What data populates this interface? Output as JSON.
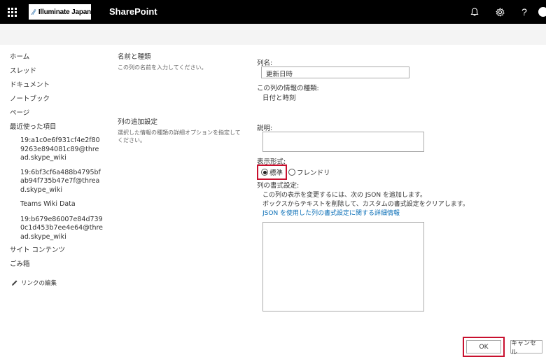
{
  "suitebar": {
    "logo_text": "Illuminate Japan",
    "app_title": "SharePoint"
  },
  "leftnav": {
    "items": [
      {
        "label": "ホーム"
      },
      {
        "label": "スレッド"
      },
      {
        "label": "ドキュメント"
      },
      {
        "label": "ノートブック"
      },
      {
        "label": "ページ"
      },
      {
        "label": "最近使った項目"
      }
    ],
    "recent": [
      "19:a1c0e6f931cf4e2f809263e894081c89@thread.skype_wiki",
      "19:6bf3cf6a488b4795bfab94f735b47e7f@thread.skype_wiki",
      "Teams Wiki Data",
      "19:b679e86007e84d7390c1d453b7ee4e64@thread.skype_wiki"
    ],
    "site_contents": "サイト コンテンツ",
    "recycle_bin": "ごみ箱",
    "edit_links": "リンクの編集"
  },
  "form": {
    "section1_title": "名前と種類",
    "section1_desc": "この列の名前を入力してください。",
    "section2_title": "列の追加設定",
    "section2_desc": "選択した情報の種類の詳細オプションを指定してください。",
    "column_name_label": "列名:",
    "column_name_value": "更新日時",
    "info_type_label": "この列の情報の種類:",
    "info_type_value": "日付と時刻",
    "description_label": "説明:",
    "display_format_label": "表示形式:",
    "radio_standard": "標準",
    "radio_friendly": "フレンドリ",
    "column_format_label": "列の書式設定:",
    "format_help_1": "この列の表示を変更するには、次の JSON を追加します。",
    "format_help_2": "ボックスからテキストを削除して、カスタムの書式設定をクリアします。",
    "format_link": "JSON を使用した列の書式設定に関する詳細情報"
  },
  "buttons": {
    "ok": "OK",
    "cancel": "キャンセル"
  },
  "colors": {
    "suitebar": "#000000",
    "highlight": "#c8102e",
    "link": "#0b6fb7"
  },
  "icons": [
    "app-launcher-icon",
    "bell-icon",
    "gear-icon",
    "help-icon",
    "profile-icon",
    "pencil-icon"
  ]
}
